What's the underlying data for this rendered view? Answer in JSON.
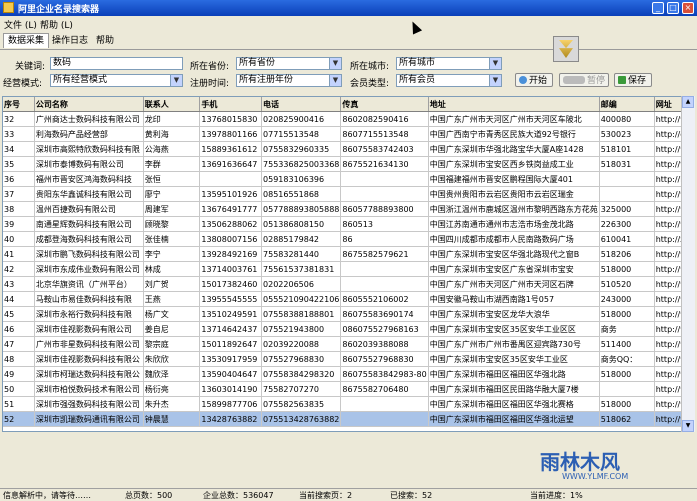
{
  "window": {
    "title": "阿里企业名录搜索器",
    "minimize": "_",
    "maximize": "□",
    "close": "×"
  },
  "menu": [
    {
      "label": "文件 (L)"
    },
    {
      "label": "帮助 (L)"
    }
  ],
  "tabs": [
    {
      "label": "数据采集",
      "active": true
    },
    {
      "label": "操作日志",
      "active": false
    },
    {
      "label": "帮助",
      "active": false
    }
  ],
  "form": {
    "keyword_label": "关键词:",
    "keyword_value": "数码",
    "province_label": "所在省份:",
    "province_value": "所有省份",
    "city_label": "所在城市:",
    "city_value": "所有城市",
    "mode_label": "经营模式:",
    "mode_value": "所有经营模式",
    "regtime_label": "注册时间:",
    "regtime_value": "所有注册年份",
    "member_label": "会员类型:",
    "member_value": "所有会员"
  },
  "buttons": {
    "start": "开始",
    "pause": "暂停",
    "save": "保存"
  },
  "table": {
    "columns": [
      "序号",
      "公司名称",
      "联系人",
      "手机",
      "电话",
      "传真",
      "地址",
      "邮编",
      "网址"
    ],
    "rows": [
      [
        "32",
        "广州商达士数码科技有限公司",
        "龙印",
        "13768015830",
        "020825900416",
        "8602082590416",
        "中国广东广州市天河区广州市天河区车陂北",
        "400080",
        "http://w"
      ],
      [
        "33",
        "利海数码产品经营部",
        "黄利海",
        "13978801166",
        "07715513548",
        "8607715513548",
        "中国广西南宁市青秀区民族大道92号银行",
        "530023",
        "http://gx"
      ],
      [
        "34",
        "深圳市高熙特欣数码科技有限",
        "公海燕",
        "15889361612",
        "0755832960335",
        "8607558374240​3",
        "中国广东深圳市华强北路宝华大厦A座1428",
        "518101",
        "http://w"
      ],
      [
        "35",
        "深圳市泰博数码有限公司",
        "李群",
        "13691636647",
        "75533682500336​8",
        "8675521634130",
        "中国广东深圳市宝安区西乡铁岗益成工业",
        "518031",
        "http://tai"
      ],
      [
        "36",
        "福州市晋安区鸿海数码科技",
        "张恒",
        "",
        "059183106396",
        "",
        "中国福建福州市晋安区鹏程国际大厦401",
        "",
        "http://h"
      ],
      [
        "37",
        "贵阳东华鑫诚科技有限公司",
        "廖宁",
        "13595101926",
        "08516551868",
        "",
        "中国贵州贵阳市云岩区贵阳市云岩区瑞金",
        "",
        "http://w"
      ],
      [
        "38",
        "温州百捷数码有限公司",
        "周建军",
        "13676491777",
        "05778889380588​8",
        "8605778889380​0",
        "中国浙江温州市鹿城区温州市黎明西路东方花苑",
        "325000",
        "http://w"
      ],
      [
        "39",
        "南通星辉数码科技有限公司",
        "顾晓黎",
        "13506288062",
        "05138680815​0",
        "860513",
        "中国江苏南通市通州市志浩市场金茂北路",
        "226300",
        "http://w"
      ],
      [
        "40",
        "成都登海数码科技有限公司",
        "张佳楠",
        "13808007156",
        "02885179842",
        "86",
        "中国四川成都市成都市人民南路数码广场",
        "610041",
        "http://zt"
      ],
      [
        "41",
        "深圳市鹏飞数码科技有限公司",
        "李宁",
        "13928492169",
        "75583281440",
        "8675582579621",
        "中国广东深圳市宝安区华强北路现代之窗B",
        "518206",
        "http://w"
      ],
      [
        "42",
        "深圳市东成伟业数码有限公司",
        "林成",
        "13714003761",
        "75561537381831",
        "",
        "中国广东深圳市宝安区广东省深圳市宝安",
        "518000",
        "http://w"
      ],
      [
        "43",
        "北京华旗资讯（广州平台）",
        "刘广贺",
        "15017382460",
        "0202206506",
        "",
        "中国广东广州市天河区广州市天河区石牌",
        "510520",
        "http://w"
      ],
      [
        "44",
        "马鞍山市易佳数码科技有限",
        "王燕",
        "13955545555",
        "0555210904221​06",
        "8605552106002",
        "中国安徽马鞍山市湖西南路1号057",
        "243000",
        "http://w"
      ],
      [
        "45",
        "深圳市永裕行数码科技有限",
        "杨广文",
        "13510249591",
        "0755838818880​1",
        "8607558369017​4",
        "中国广东深圳市宝安区龙华大浪华",
        "518000",
        "http://w"
      ],
      [
        "46",
        "深圳市佳视影数码有限公司",
        "姜自尼",
        "13714642437",
        "07552194380​0",
        "0860755279681​63",
        "中国广东深圳市宝安区35区安华工业区区",
        "商务",
        "http://w"
      ],
      [
        "47",
        "广州市非星数码科技有限公司",
        "黎宗庭",
        "15011892647",
        "02039220088",
        "8602039388088",
        "中国广东广州市广州市番禺区迎宾路730号",
        "511400",
        "http://w"
      ],
      [
        "48",
        "深圳市佳视影数码科技有限公",
        "朱欣欣",
        "13530917959",
        "07552796883​0",
        "8607552796883​0",
        "中国广东深圳市宝安区35区安华工业区",
        "商务QQ：",
        "http://w"
      ],
      [
        "49",
        "深圳市柯瑞达数码科技有限公",
        "魏欣泽",
        "13590404647",
        "0755838429832​0",
        "8607558384298​3-80",
        "中国广东深圳市福田区福田区华强北路",
        "518000",
        "http://w"
      ],
      [
        "50",
        "深圳市柏悦数码技术有限公司",
        "杨衍亮",
        "13603014190",
        "75582707270",
        "8675582706480",
        "中国广东深圳市福田区民田路华融大厦7楼",
        "",
        "http://w"
      ],
      [
        "51",
        "深圳市强强数码科技有限公司",
        "朱升杰",
        "15899877706",
        "07558256383​5",
        "",
        "中国广东深圳市福田区福田区华强北赛格",
        "518000",
        "http://w"
      ],
      [
        "52",
        "深圳市凯瑞数码通讯有限公司",
        "钟晨慧",
        "13428763882",
        "0755134287638​82",
        "",
        "中国广东深圳市福田区福田区华强北运望",
        "518062",
        "http://yy"
      ]
    ],
    "selected_row": 20
  },
  "status": {
    "info": "信息解析中，请等待……",
    "total_pages": "总页数：500",
    "total_companies": "企业总数：536047",
    "current_page": "当前搜索页：2",
    "crawled": "已搜索：52",
    "progress": "当前进度：1%"
  },
  "watermark": {
    "main": "雨林木风",
    "url": "WWW.YLMF.COM"
  }
}
